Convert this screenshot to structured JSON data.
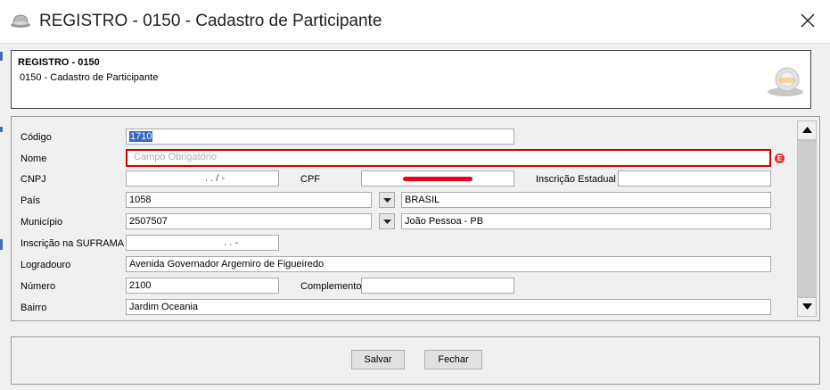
{
  "window": {
    "title": "REGISTRO - 0150 - Cadastro de Participante"
  },
  "header": {
    "title": "REGISTRO - 0150",
    "subtitle": "0150 - Cadastro de Participante"
  },
  "form": {
    "codigo": {
      "label": "Código",
      "value": "1710"
    },
    "nome": {
      "label": "Nome",
      "placeholder": "Campo Obrigatório",
      "error_badge": "E"
    },
    "cnpj": {
      "label": "CNPJ",
      "value": ". . / -"
    },
    "cpf": {
      "label": "CPF"
    },
    "inscricao_estadual": {
      "label": "Inscrição Estadual",
      "value": ""
    },
    "pais": {
      "label": "País",
      "code": "1058",
      "name": "BRASIL"
    },
    "municipio": {
      "label": "Município",
      "code": "2507507",
      "name": "João Pessoa - PB"
    },
    "suframa": {
      "label": "Inscrição na SUFRAMA",
      "value": ". . -"
    },
    "logradouro": {
      "label": "Logradouro",
      "value": "Avenida Governador Argemiro de Figueiredo"
    },
    "numero": {
      "label": "Número",
      "value": "2100"
    },
    "complemento": {
      "label": "Complemento",
      "value": ""
    },
    "bairro": {
      "label": "Bairro",
      "value": "Jardim Oceania"
    }
  },
  "buttons": {
    "save": "Salvar",
    "close": "Fechar"
  },
  "colors": {
    "error": "#d00000",
    "selection": "#316ac5",
    "redaction": "#e8001c"
  }
}
